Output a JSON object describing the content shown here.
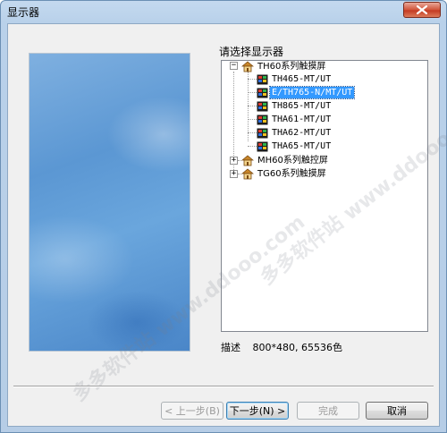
{
  "window": {
    "title": "显示器"
  },
  "tree": {
    "label": "请选择显示器",
    "groups": [
      {
        "label": "TH60系列触摸屏",
        "expanded": true,
        "items": [
          "TH465-MT/UT",
          "E/TH765-N/MT/UT",
          "TH865-MT/UT",
          "THA61-MT/UT",
          "THA62-MT/UT",
          "THA65-MT/UT"
        ]
      },
      {
        "label": "MH60系列触控屏",
        "expanded": false
      },
      {
        "label": "TG60系列触摸屏",
        "expanded": false
      }
    ],
    "selected_item": "E/TH765-N/MT/UT"
  },
  "description": {
    "label": "描述",
    "value": "800*480, 65536色"
  },
  "buttons": {
    "back": "< 上一步(B)",
    "next": "下一步(N) >",
    "finish": "完成",
    "cancel": "取消"
  },
  "watermark": {
    "text": "多多软件站 www.ddooo.com"
  },
  "colors": {
    "selection": "#3399ff",
    "close_button": "#c43b22"
  }
}
